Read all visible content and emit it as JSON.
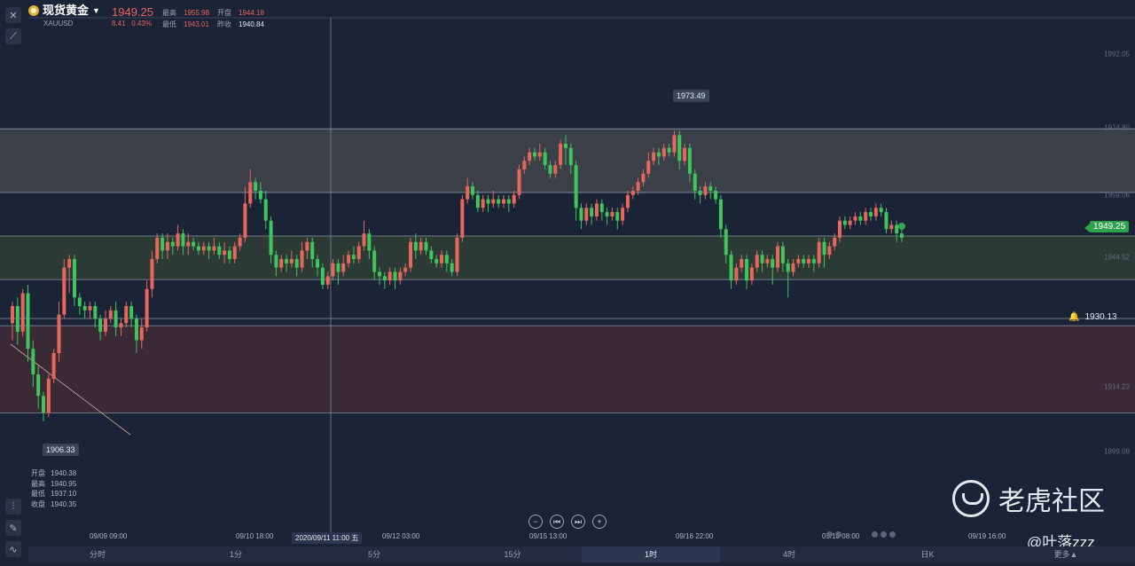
{
  "header": {
    "symbol_name": "现货黄金",
    "symbol_code": "XAUUSD",
    "price": "1949.25",
    "change": "8.41",
    "change_pct": "0.43%",
    "stats": [
      {
        "label": "最高",
        "value": "1955.98",
        "color": "red"
      },
      {
        "label": "开盘",
        "value": "1944.18",
        "color": "red"
      },
      {
        "label": "最低",
        "value": "1943.01",
        "color": "red"
      },
      {
        "label": "昨收",
        "value": "1940.84",
        "color": "white"
      }
    ]
  },
  "ohlc_readout": [
    {
      "label": "开盘",
      "value": "1940.38"
    },
    {
      "label": "最高",
      "value": "1940.95"
    },
    {
      "label": "最低",
      "value": "1937.10"
    },
    {
      "label": "收盘",
      "value": "1940.35"
    }
  ],
  "tools": {
    "top": [
      "close-icon",
      "trendline-icon"
    ],
    "bottom": [
      "indicators-icon",
      "pen-icon",
      "chart-type-icon"
    ]
  },
  "current_price_tag": "1949.25",
  "alert_price": "1930.13",
  "callout_high": "1973.49",
  "callout_low": "1906.33",
  "crosshair_time": "2020/09/11 11:00 五",
  "time_labels": [
    "09/09 09:00",
    "09/10 18:00",
    "09/12 03:00",
    "09/15 13:00",
    "09/16 22:00",
    "09/18 08:00",
    "09/19 16:00"
  ],
  "period_tabs": [
    "分时",
    "1分",
    "5分",
    "15分",
    "1时",
    "4时",
    "日K",
    "更多▲"
  ],
  "active_tab": "1时",
  "nav_buttons": [
    "−",
    "⏮",
    "⏭",
    "+"
  ],
  "watermark": {
    "brand": "老虎社区",
    "handle": "@叶落zzz"
  },
  "chart_data": {
    "type": "candlestick",
    "y_ticks": [
      "1992.05",
      "1974.80",
      "1959.06",
      "1944.52",
      "1914.23",
      "1899.09"
    ],
    "y_range": [
      1895,
      1998
    ],
    "zones": [
      {
        "from": 1959.6,
        "to": 1974.5,
        "color": "#3a3f48"
      },
      {
        "from": 1939.2,
        "to": 1949.4,
        "color": "#2c3a35"
      },
      {
        "from": 1908.0,
        "to": 1928.4,
        "color": "#3a2a35"
      }
    ],
    "hlines": [
      1974.5,
      1959.6,
      1949.4,
      1939.2,
      1930.1,
      1928.4,
      1908.0
    ],
    "candles": [
      [
        1929,
        1933,
        1925,
        1934
      ],
      [
        1933,
        1927,
        1924,
        1935
      ],
      [
        1927,
        1936,
        1926,
        1937
      ],
      [
        1936,
        1923,
        1920,
        1938
      ],
      [
        1923,
        1917,
        1914,
        1925
      ],
      [
        1917,
        1912,
        1909,
        1919
      ],
      [
        1912,
        1908,
        1906,
        1913
      ],
      [
        1908,
        1916,
        1907,
        1917
      ],
      [
        1916,
        1922,
        1915,
        1923
      ],
      [
        1922,
        1931,
        1920,
        1934
      ],
      [
        1931,
        1942,
        1930,
        1944
      ],
      [
        1942,
        1944,
        1936,
        1945
      ],
      [
        1944,
        1935,
        1933,
        1945
      ],
      [
        1935,
        1933,
        1931,
        1936
      ],
      [
        1933,
        1932,
        1930,
        1934
      ],
      [
        1932,
        1933,
        1930,
        1934
      ],
      [
        1933,
        1930,
        1928,
        1934
      ],
      [
        1930,
        1927,
        1925,
        1931
      ],
      [
        1927,
        1930,
        1926,
        1932
      ],
      [
        1930,
        1932,
        1929,
        1933
      ],
      [
        1932,
        1928,
        1926,
        1934
      ],
      [
        1928,
        1929,
        1926,
        1930
      ],
      [
        1929,
        1933,
        1928,
        1934
      ],
      [
        1933,
        1930,
        1928,
        1934
      ],
      [
        1930,
        1925,
        1922,
        1931
      ],
      [
        1925,
        1928,
        1923,
        1930
      ],
      [
        1928,
        1937,
        1927,
        1939
      ],
      [
        1937,
        1944,
        1935,
        1946
      ],
      [
        1944,
        1949,
        1943,
        1950
      ],
      [
        1949,
        1946,
        1944,
        1950
      ],
      [
        1946,
        1948,
        1944,
        1950
      ],
      [
        1948,
        1947,
        1945,
        1949
      ],
      [
        1947,
        1950,
        1946,
        1952
      ],
      [
        1950,
        1947,
        1945,
        1951
      ],
      [
        1947,
        1948,
        1945,
        1950
      ],
      [
        1948,
        1947,
        1946,
        1949
      ],
      [
        1947,
        1946,
        1945,
        1948
      ],
      [
        1946,
        1947,
        1945,
        1948
      ],
      [
        1947,
        1946,
        1944,
        1948
      ],
      [
        1946,
        1947,
        1945,
        1949
      ],
      [
        1947,
        1945,
        1944,
        1948
      ],
      [
        1945,
        1946,
        1943,
        1948
      ],
      [
        1946,
        1944,
        1943,
        1947
      ],
      [
        1944,
        1947,
        1943,
        1948
      ],
      [
        1947,
        1949,
        1946,
        1950
      ],
      [
        1949,
        1957,
        1948,
        1961
      ],
      [
        1957,
        1962,
        1956,
        1965
      ],
      [
        1962,
        1960,
        1958,
        1963
      ],
      [
        1960,
        1958,
        1957,
        1962
      ],
      [
        1958,
        1953,
        1951,
        1960
      ],
      [
        1953,
        1945,
        1943,
        1954
      ],
      [
        1945,
        1942,
        1940,
        1946
      ],
      [
        1942,
        1944,
        1941,
        1945
      ],
      [
        1944,
        1943,
        1941,
        1945
      ],
      [
        1943,
        1944,
        1942,
        1946
      ],
      [
        1944,
        1942,
        1940,
        1945
      ],
      [
        1942,
        1946,
        1941,
        1948
      ],
      [
        1946,
        1948,
        1944,
        1949
      ],
      [
        1948,
        1944,
        1942,
        1949
      ],
      [
        1944,
        1942,
        1940,
        1945
      ],
      [
        1942,
        1938,
        1937,
        1943
      ],
      [
        1938,
        1940,
        1937,
        1941
      ],
      [
        1940,
        1943,
        1939,
        1944
      ],
      [
        1943,
        1941,
        1938,
        1944
      ],
      [
        1941,
        1943,
        1940,
        1945
      ],
      [
        1943,
        1945,
        1942,
        1946
      ],
      [
        1945,
        1944,
        1943,
        1947
      ],
      [
        1944,
        1947,
        1943,
        1948
      ],
      [
        1947,
        1950,
        1946,
        1953
      ],
      [
        1950,
        1946,
        1944,
        1951
      ],
      [
        1946,
        1941,
        1939,
        1947
      ],
      [
        1941,
        1940,
        1938,
        1942
      ],
      [
        1940,
        1939,
        1937,
        1941
      ],
      [
        1939,
        1941,
        1938,
        1942
      ],
      [
        1941,
        1939,
        1937,
        1942
      ],
      [
        1939,
        1941,
        1938,
        1942
      ],
      [
        1941,
        1942,
        1940,
        1943
      ],
      [
        1942,
        1948,
        1941,
        1949
      ],
      [
        1948,
        1946,
        1944,
        1950
      ],
      [
        1946,
        1948,
        1945,
        1949
      ],
      [
        1948,
        1946,
        1945,
        1949
      ],
      [
        1946,
        1944,
        1943,
        1947
      ],
      [
        1944,
        1943,
        1942,
        1945
      ],
      [
        1943,
        1945,
        1942,
        1946
      ],
      [
        1945,
        1943,
        1941,
        1946
      ],
      [
        1943,
        1941,
        1940,
        1944
      ],
      [
        1941,
        1949,
        1940,
        1950
      ],
      [
        1949,
        1958,
        1948,
        1959
      ],
      [
        1958,
        1961,
        1957,
        1963
      ],
      [
        1961,
        1959,
        1958,
        1962
      ],
      [
        1959,
        1956,
        1955,
        1960
      ],
      [
        1956,
        1958,
        1955,
        1959
      ],
      [
        1958,
        1957,
        1955,
        1959
      ],
      [
        1957,
        1958,
        1956,
        1960
      ],
      [
        1958,
        1957,
        1956,
        1959
      ],
      [
        1957,
        1958,
        1956,
        1959
      ],
      [
        1958,
        1957,
        1955,
        1959
      ],
      [
        1957,
        1959,
        1956,
        1960
      ],
      [
        1959,
        1965,
        1958,
        1966
      ],
      [
        1965,
        1967,
        1964,
        1968
      ],
      [
        1967,
        1969,
        1966,
        1970
      ],
      [
        1969,
        1968,
        1967,
        1970
      ],
      [
        1968,
        1969,
        1967,
        1971
      ],
      [
        1969,
        1966,
        1965,
        1970
      ],
      [
        1966,
        1964,
        1963,
        1967
      ],
      [
        1964,
        1966,
        1963,
        1967
      ],
      [
        1966,
        1971,
        1965,
        1972
      ],
      [
        1971,
        1970,
        1966,
        1973
      ],
      [
        1970,
        1966,
        1964,
        1971
      ],
      [
        1966,
        1956,
        1953,
        1967
      ],
      [
        1956,
        1953,
        1951,
        1957
      ],
      [
        1953,
        1956,
        1952,
        1957
      ],
      [
        1956,
        1954,
        1952,
        1957
      ],
      [
        1954,
        1957,
        1953,
        1958
      ],
      [
        1957,
        1955,
        1953,
        1958
      ],
      [
        1955,
        1954,
        1952,
        1956
      ],
      [
        1954,
        1955,
        1953,
        1956
      ],
      [
        1955,
        1953,
        1951,
        1956
      ],
      [
        1953,
        1956,
        1952,
        1957
      ],
      [
        1956,
        1959,
        1955,
        1960
      ],
      [
        1959,
        1960,
        1958,
        1961
      ],
      [
        1960,
        1962,
        1959,
        1963
      ],
      [
        1962,
        1964,
        1961,
        1965
      ],
      [
        1964,
        1967,
        1963,
        1969
      ],
      [
        1967,
        1969,
        1966,
        1970
      ],
      [
        1969,
        1968,
        1966,
        1970
      ],
      [
        1968,
        1970,
        1967,
        1971
      ],
      [
        1970,
        1969,
        1968,
        1971
      ],
      [
        1969,
        1973,
        1968,
        1974
      ],
      [
        1973,
        1967,
        1965,
        1974
      ],
      [
        1967,
        1970,
        1966,
        1971
      ],
      [
        1970,
        1964,
        1962,
        1971
      ],
      [
        1964,
        1960,
        1958,
        1965
      ],
      [
        1960,
        1959,
        1957,
        1961
      ],
      [
        1959,
        1961,
        1958,
        1962
      ],
      [
        1961,
        1960,
        1958,
        1962
      ],
      [
        1960,
        1958,
        1957,
        1961
      ],
      [
        1958,
        1951,
        1949,
        1959
      ],
      [
        1951,
        1945,
        1943,
        1952
      ],
      [
        1945,
        1939,
        1937,
        1946
      ],
      [
        1939,
        1942,
        1938,
        1943
      ],
      [
        1942,
        1944,
        1941,
        1945
      ],
      [
        1944,
        1939,
        1937,
        1945
      ],
      [
        1939,
        1942,
        1938,
        1943
      ],
      [
        1942,
        1945,
        1941,
        1946
      ],
      [
        1945,
        1943,
        1941,
        1946
      ],
      [
        1943,
        1944,
        1942,
        1945
      ],
      [
        1944,
        1942,
        1938,
        1945
      ],
      [
        1942,
        1947,
        1941,
        1948
      ],
      [
        1947,
        1943,
        1941,
        1948
      ],
      [
        1943,
        1941,
        1935,
        1944
      ],
      [
        1941,
        1943,
        1940,
        1944
      ],
      [
        1943,
        1944,
        1942,
        1945
      ],
      [
        1944,
        1943,
        1942,
        1945
      ],
      [
        1943,
        1944,
        1942,
        1945
      ],
      [
        1944,
        1943,
        1941,
        1945
      ],
      [
        1943,
        1948,
        1942,
        1949
      ],
      [
        1948,
        1945,
        1942,
        1949
      ],
      [
        1945,
        1947,
        1944,
        1948
      ],
      [
        1947,
        1949,
        1946,
        1950
      ],
      [
        1949,
        1953,
        1948,
        1954
      ],
      [
        1953,
        1952,
        1951,
        1954
      ],
      [
        1952,
        1953,
        1951,
        1954
      ],
      [
        1953,
        1954,
        1952,
        1955
      ],
      [
        1954,
        1953,
        1952,
        1955
      ],
      [
        1953,
        1955,
        1952,
        1956
      ],
      [
        1955,
        1954,
        1953,
        1956
      ],
      [
        1954,
        1956,
        1953,
        1957
      ],
      [
        1956,
        1955,
        1954,
        1957
      ],
      [
        1955,
        1951,
        1950,
        1956
      ],
      [
        1951,
        1952,
        1950,
        1953
      ],
      [
        1952,
        1950,
        1948,
        1953
      ],
      [
        1950,
        1949,
        1948,
        1951
      ]
    ]
  }
}
